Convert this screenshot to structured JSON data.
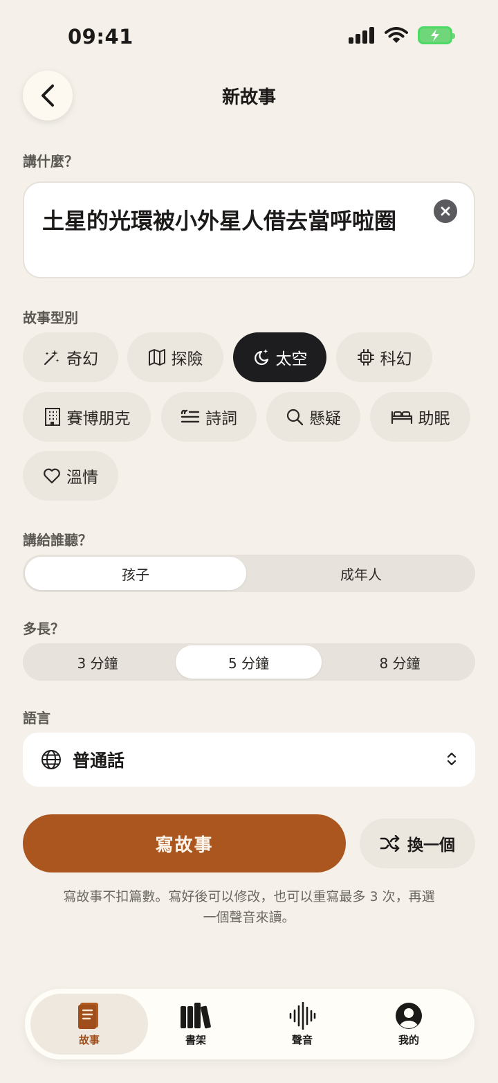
{
  "status": {
    "time": "09:41"
  },
  "header": {
    "title": "新故事"
  },
  "prompt": {
    "label": "講什麼？",
    "value": "土星的光環被小外星人借去當呼啦圈"
  },
  "genre": {
    "label": "故事型別",
    "chips": [
      {
        "label": "奇幻",
        "icon": "sparkle-wand-icon",
        "active": false
      },
      {
        "label": "探險",
        "icon": "map-icon",
        "active": false
      },
      {
        "label": "太空",
        "icon": "moon-star-icon",
        "active": true
      },
      {
        "label": "科幻",
        "icon": "chip-icon",
        "active": false
      },
      {
        "label": "賽博朋克",
        "icon": "building-icon",
        "active": false
      },
      {
        "label": "詩詞",
        "icon": "quote-lines-icon",
        "active": false
      },
      {
        "label": "懸疑",
        "icon": "search-icon",
        "active": false
      },
      {
        "label": "助眠",
        "icon": "bed-icon",
        "active": false
      },
      {
        "label": "溫情",
        "icon": "heart-icon",
        "active": false
      }
    ]
  },
  "audience": {
    "label": "講給誰聽？",
    "options": [
      "孩子",
      "成年人"
    ],
    "selected": "孩子"
  },
  "length": {
    "label": "多長？",
    "options": [
      "3 分鐘",
      "5 分鐘",
      "8 分鐘"
    ],
    "selected": "5 分鐘"
  },
  "language": {
    "label": "語言",
    "value": "普通話"
  },
  "actions": {
    "write_label": "寫故事",
    "shuffle_label": "換一個"
  },
  "note": "寫故事不扣篇數。寫好後可以修改，也可以重寫最多 3 次，再選一個聲音來讀。",
  "tabs": [
    {
      "label": "故事",
      "icon": "book-icon",
      "active": true
    },
    {
      "label": "書架",
      "icon": "bookshelf-icon",
      "active": false
    },
    {
      "label": "聲音",
      "icon": "waveform-icon",
      "active": false
    },
    {
      "label": "我的",
      "icon": "profile-icon",
      "active": false
    }
  ],
  "colors": {
    "accent": "#ab561f",
    "background": "#f5f1ea",
    "chip_active": "#1d1c1f"
  }
}
